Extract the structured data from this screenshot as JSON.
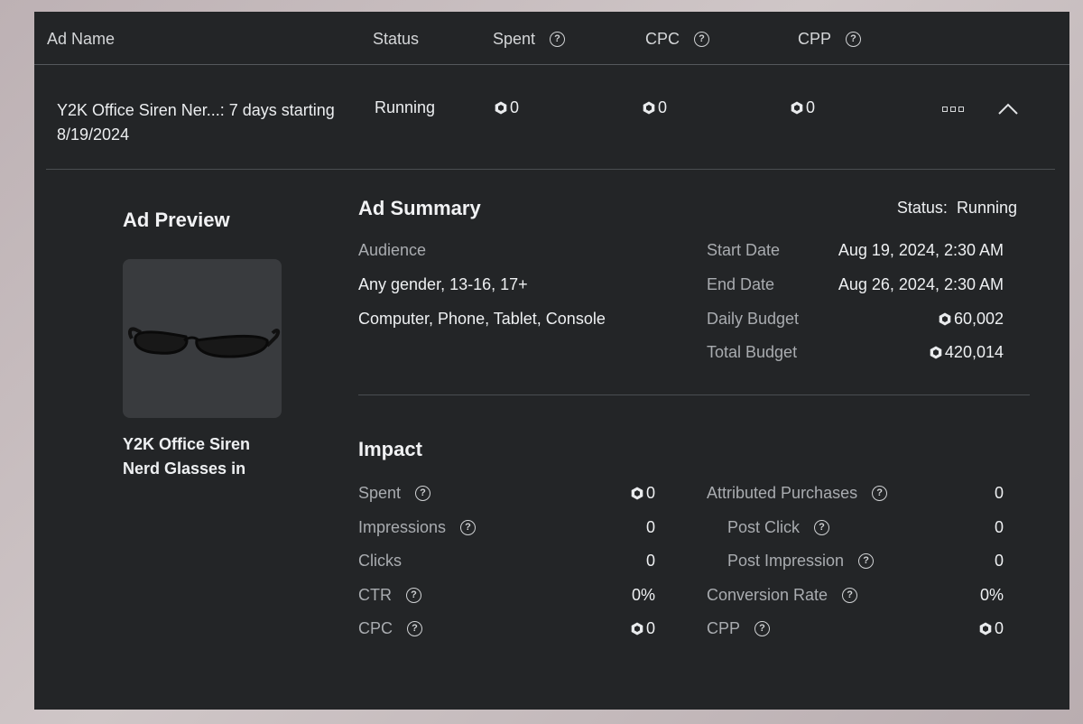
{
  "table": {
    "headers": {
      "ad_name": "Ad Name",
      "status": "Status",
      "spent": "Spent",
      "cpc": "CPC",
      "cpp": "CPP"
    },
    "row": {
      "ad_name_line1": "Y2K Office Siren Ner...: 7 days starting",
      "ad_name_line2": "8/19/2024",
      "status": "Running",
      "spent": "0",
      "cpc": "0",
      "cpp": "0"
    }
  },
  "preview": {
    "heading": "Ad Preview",
    "item_name_line1": "Y2K Office Siren",
    "item_name_line2": "Nerd Glasses in"
  },
  "summary": {
    "heading": "Ad Summary",
    "status_label": "Status:",
    "status_value": "Running",
    "audience_label": "Audience",
    "audience_demo": "Any gender, 13-16, 17+",
    "audience_devices": "Computer, Phone, Tablet, Console",
    "start_label": "Start Date",
    "start_value": "Aug 19, 2024, 2:30 AM",
    "end_label": "End Date",
    "end_value": "Aug 26, 2024, 2:30 AM",
    "daily_label": "Daily Budget",
    "daily_value": "60,002",
    "total_label": "Total Budget",
    "total_value": "420,014"
  },
  "impact": {
    "heading": "Impact",
    "spent_label": "Spent",
    "spent_value": "0",
    "impressions_label": "Impressions",
    "impressions_value": "0",
    "clicks_label": "Clicks",
    "clicks_value": "0",
    "ctr_label": "CTR",
    "ctr_value": "0%",
    "cpc_label": "CPC",
    "cpc_value": "0",
    "attributed_label": "Attributed Purchases",
    "attributed_value": "0",
    "post_click_label": "Post Click",
    "post_click_value": "0",
    "post_impression_label": "Post Impression",
    "post_impression_value": "0",
    "conversion_label": "Conversion Rate",
    "conversion_value": "0%",
    "cpp_label": "CPP",
    "cpp_value": "0"
  },
  "icons": {
    "help": "question-circle-icon",
    "currency": "robux-icon",
    "more": "more-options-icon",
    "collapse": "chevron-up-icon"
  },
  "colors": {
    "panel": "#232527",
    "background": "#c5babc",
    "text": "#eceef0",
    "muted": "#a9acb0"
  }
}
